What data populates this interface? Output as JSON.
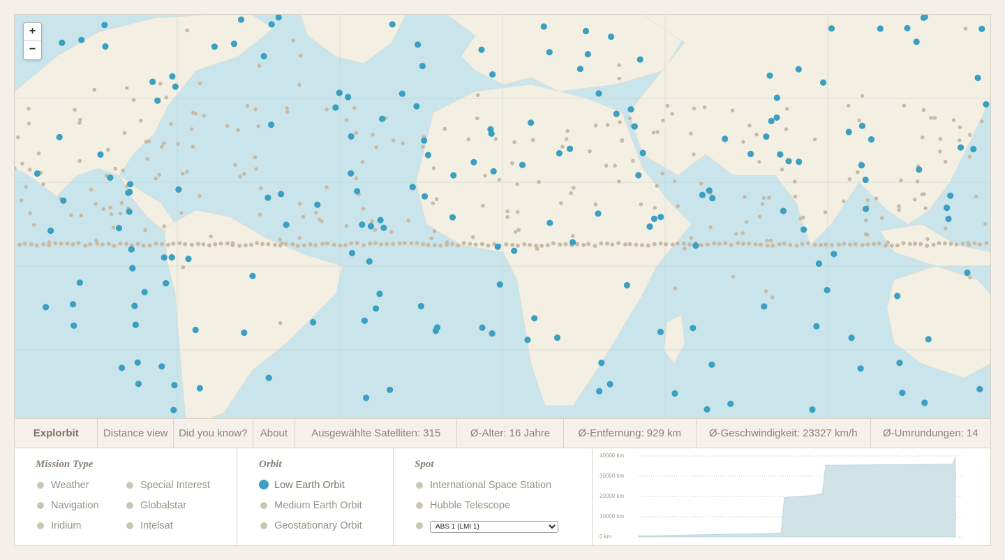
{
  "map": {
    "zoom_in": "+",
    "zoom_out": "−",
    "colors": {
      "ocean": "#c9e4ea",
      "land": "#f4efe3",
      "selected": "#3a9fc1",
      "unselected": "#c7bba6"
    }
  },
  "nav": {
    "brand": "Explorbit",
    "distance_view": "Distance view",
    "did_you_know": "Did you know?",
    "about": "About",
    "selected_sats": "Ausgewählte Satelliten: 315",
    "avg_age": "Ø-Alter: 16 Jahre",
    "avg_distance": "Ø-Entfernung: 929 km",
    "avg_speed": "Ø-Geschwindigkeit: 23327 km/h",
    "avg_orbits": "Ø-Umrundungen: 14"
  },
  "filters": {
    "mission_type": {
      "title": "Mission Type",
      "items": [
        "Weather",
        "Navigation",
        "Iridium",
        "Special Interest",
        "Globalstar",
        "Intelsat"
      ]
    },
    "orbit": {
      "title": "Orbit",
      "items": [
        "Low Earth Orbit",
        "Medium Earth Orbit",
        "Geostationary Orbit"
      ],
      "active": "Low Earth Orbit"
    },
    "spot": {
      "title": "Spot",
      "items": [
        "International Space Station",
        "Hubble Telescope"
      ],
      "select_value": "ABS 1 (LMI 1)"
    }
  },
  "chart_data": {
    "type": "area",
    "ylim": [
      0,
      40000
    ],
    "yticks": [
      "40000 km",
      "30000 km",
      "20000 km",
      "10000 km",
      "0 km"
    ],
    "x": [
      0,
      10,
      20,
      30,
      40,
      45,
      46,
      50,
      55,
      58,
      59,
      70,
      80,
      90,
      99,
      100
    ],
    "values": [
      500,
      800,
      1100,
      1400,
      1700,
      2000,
      19500,
      20000,
      20500,
      21500,
      35500,
      35600,
      35700,
      35800,
      36000,
      39500
    ],
    "color": "#cfe3e6"
  }
}
